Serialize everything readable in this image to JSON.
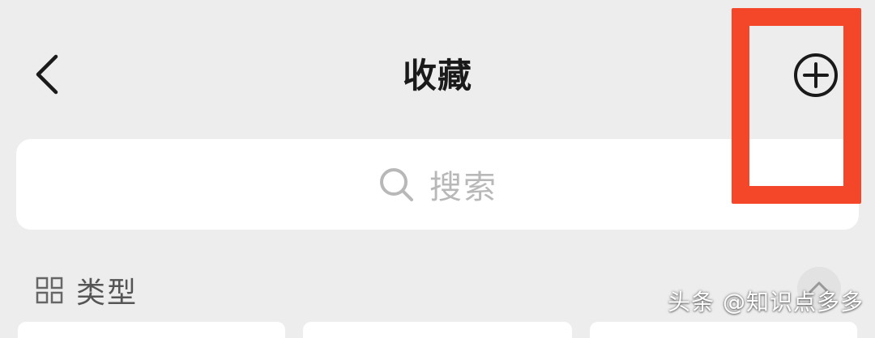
{
  "header": {
    "title": "收藏"
  },
  "search": {
    "placeholder": "搜索"
  },
  "section": {
    "label": "类型"
  },
  "watermark": {
    "text": "头条 @知识点多多"
  },
  "icons": {
    "back": "chevron-left-icon",
    "add": "plus-circle-icon",
    "search": "search-icon",
    "grid": "grid-icon",
    "collapse": "chevron-up-icon"
  },
  "colors": {
    "background": "#ededed",
    "highlight": "#f4472a",
    "title": "#1a1a1a",
    "placeholder": "#b8b8b8"
  }
}
